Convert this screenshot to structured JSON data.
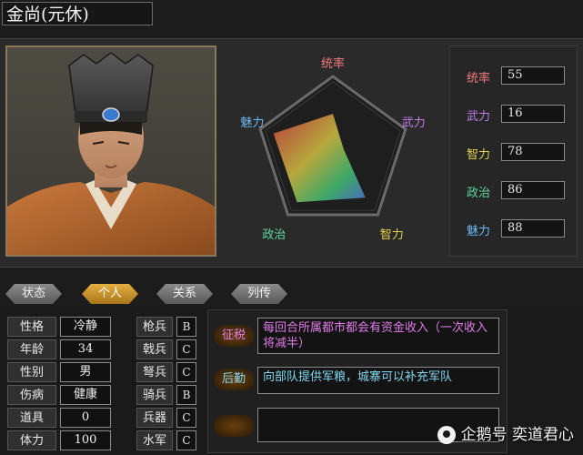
{
  "officer": {
    "name": "金尚(元休)"
  },
  "radar": {
    "labels": [
      "统率",
      "武力",
      "智力",
      "政治",
      "魅力"
    ],
    "max": 100,
    "values": [
      55,
      16,
      78,
      86,
      88
    ]
  },
  "stats": [
    {
      "label": "统率",
      "value": "55",
      "color": "#f07b7b"
    },
    {
      "label": "武力",
      "value": "16",
      "color": "#c07ce8"
    },
    {
      "label": "智力",
      "value": "78",
      "color": "#e2d24a"
    },
    {
      "label": "政治",
      "value": "86",
      "color": "#5fd8a0"
    },
    {
      "label": "魅力",
      "value": "88",
      "color": "#6cb8f0"
    }
  ],
  "tabs": [
    "状态",
    "个人",
    "关系",
    "列传"
  ],
  "active_tab": "个人",
  "personal": [
    {
      "label": "性格",
      "value": "冷静"
    },
    {
      "label": "年龄",
      "value": "34"
    },
    {
      "label": "性别",
      "value": "男"
    },
    {
      "label": "伤病",
      "value": "健康"
    },
    {
      "label": "道具",
      "value": "0"
    },
    {
      "label": "体力",
      "value": "100"
    }
  ],
  "aptitudes": [
    {
      "label": "枪兵",
      "grade": "B"
    },
    {
      "label": "戟兵",
      "grade": "C"
    },
    {
      "label": "弩兵",
      "grade": "C"
    },
    {
      "label": "骑兵",
      "grade": "B"
    },
    {
      "label": "兵器",
      "grade": "C"
    },
    {
      "label": "水军",
      "grade": "C"
    }
  ],
  "skills": [
    {
      "name": "征税",
      "desc": "每回合所属都市都会有资金收入（一次收入将减半）",
      "color": "#e07be8"
    },
    {
      "name": "后勤",
      "desc": "向部队提供军粮，城寨可以补充军队",
      "color": "#7fd8f0"
    },
    {
      "name": "",
      "desc": "",
      "color": "#cfcfcf"
    }
  ],
  "watermark": "企鹅号 奕道君心"
}
